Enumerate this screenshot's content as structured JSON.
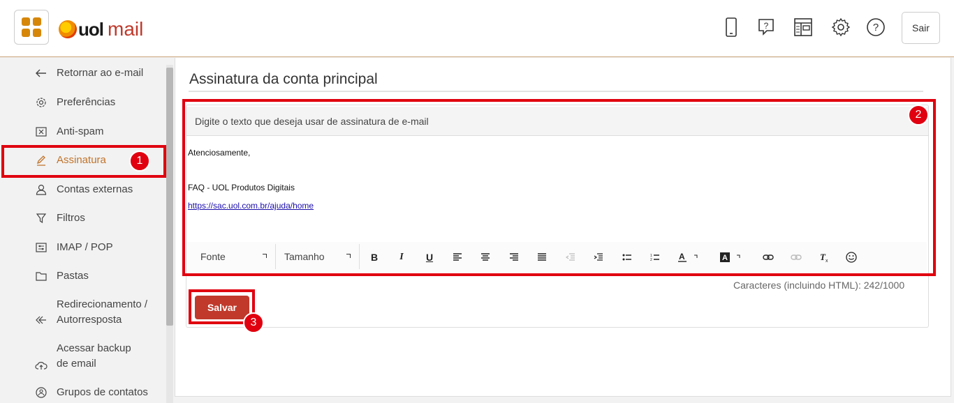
{
  "header": {
    "logo_uol": "uol",
    "logo_mail": "mail",
    "logout_label": "Sair",
    "icons": [
      "mobile-icon",
      "help-chat-icon",
      "layout-icon",
      "gear-icon",
      "help-icon"
    ]
  },
  "sidebar": {
    "items": [
      {
        "label": "Retornar ao e-mail",
        "icon": "arrow-left-icon"
      },
      {
        "label": "Preferências",
        "icon": "gear-icon"
      },
      {
        "label": "Anti-spam",
        "icon": "spam-icon"
      },
      {
        "label": "Assinatura",
        "icon": "pen-icon",
        "active": true
      },
      {
        "label": "Contas externas",
        "icon": "user-icon"
      },
      {
        "label": "Filtros",
        "icon": "filter-icon"
      },
      {
        "label": "IMAP / POP",
        "icon": "sliders-icon"
      },
      {
        "label": "Pastas",
        "icon": "folder-icon"
      },
      {
        "label": "Redirecionamento /",
        "label2": "Autorresposta",
        "icon": "reply-icon"
      },
      {
        "label": "Acessar backup",
        "label2": "de email",
        "icon": "cloud-icon"
      },
      {
        "label": "Grupos de contatos",
        "icon": "group-icon"
      }
    ]
  },
  "main": {
    "title": "Assinatura da conta principal",
    "editor": {
      "instruction": "Digite o texto que deseja usar de assinatura de e-mail",
      "lines": [
        "Atenciosamente,",
        "FAQ - UOL Produtos Digitais",
        "https://sac.uol.com.br/ajuda/home"
      ],
      "font_label": "Fonte",
      "size_label": "Tamanho"
    },
    "char_count": "Caracteres (incluindo HTML): 242/1000",
    "save_label": "Salvar"
  },
  "annotations": [
    "1",
    "2",
    "3"
  ],
  "colors": {
    "accent": "#c0392b",
    "brand_orange": "#d6870a",
    "highlight": "#e0000f",
    "active_text": "#c0732a"
  }
}
